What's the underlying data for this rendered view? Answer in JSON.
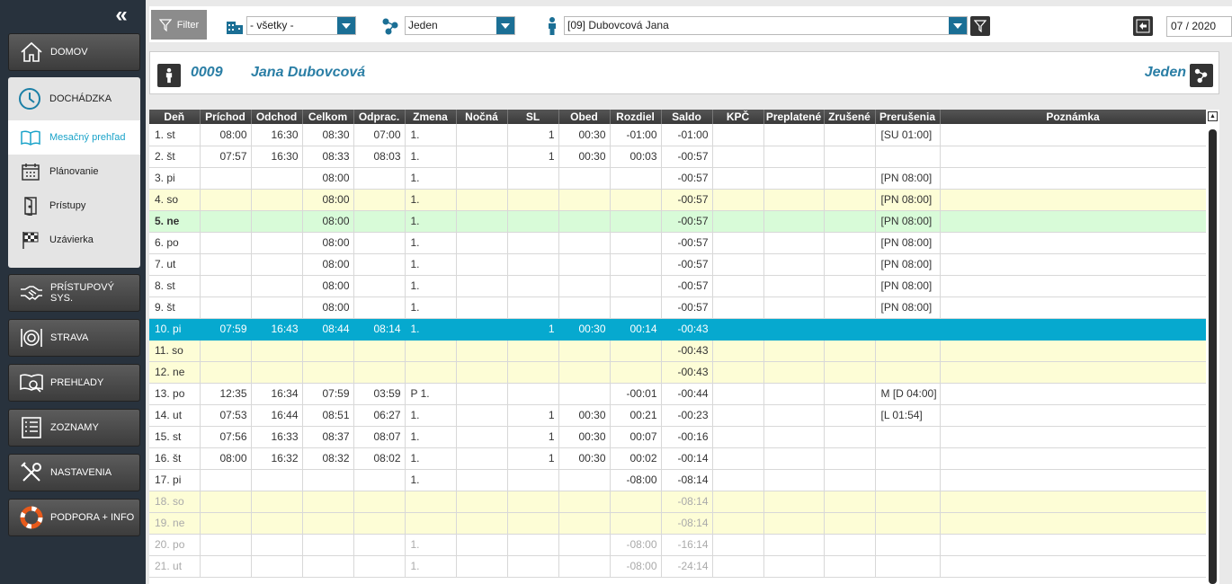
{
  "sidebar": {
    "nav": [
      {
        "id": "domov",
        "label": "DOMOV",
        "icon": "home-icon"
      },
      {
        "id": "pristupovy",
        "label": "PRÍSTUPOVÝ SYS.",
        "icon": "handshake-icon"
      },
      {
        "id": "strava",
        "label": "STRAVA",
        "icon": "plate-icon"
      },
      {
        "id": "prehlady",
        "label": "PREHĽADY",
        "icon": "book-search-icon"
      },
      {
        "id": "zoznamy",
        "label": "ZOZNAMY",
        "icon": "list-icon"
      },
      {
        "id": "nastavenia",
        "label": "NASTAVENIA",
        "icon": "tools-icon"
      },
      {
        "id": "podpora",
        "label": "PODPORA + INFO",
        "icon": "lifebuoy-icon"
      }
    ],
    "dochadzka": {
      "label": "DOCHÁDZKA",
      "items": [
        {
          "label": "Mesačný prehľad",
          "icon": "open-book-icon",
          "active": true
        },
        {
          "label": "Plánovanie",
          "icon": "calendar-icon"
        },
        {
          "label": "Prístupy",
          "icon": "door-icon"
        },
        {
          "label": "Uzávierka",
          "icon": "checkered-flag-icon"
        }
      ]
    }
  },
  "toolbar": {
    "filter_label": "Filter",
    "department_value": "- všetky -",
    "shift_value": "Jeden",
    "employee_value": "[09] Dubovcová Jana",
    "period_value": "07 / 2020"
  },
  "employee_header": {
    "code": "0009",
    "name": "Jana Dubovcová",
    "shift": "Jeden"
  },
  "table": {
    "columns": [
      "Deň",
      "Príchod",
      "Odchod",
      "Celkom",
      "Odprac.",
      "Zmena",
      "Nočná",
      "SL",
      "Obed",
      "Rozdiel",
      "Saldo",
      "KPČ",
      "Preplatené",
      "Zrušené",
      "Prerušenia",
      "Poznámka"
    ],
    "rows": [
      {
        "type": "normal",
        "cells": [
          "1. st",
          "08:00",
          "16:30",
          "08:30",
          "07:00",
          "1.",
          "",
          "1",
          "00:30",
          "-01:00",
          "-01:00",
          "",
          "",
          "",
          "[SU 01:00]",
          ""
        ]
      },
      {
        "type": "normal",
        "cells": [
          "2. št",
          "07:57",
          "16:30",
          "08:33",
          "08:03",
          "1.",
          "",
          "1",
          "00:30",
          "00:03",
          "-00:57",
          "",
          "",
          "",
          "",
          ""
        ]
      },
      {
        "type": "normal",
        "cells": [
          "3. pi",
          "",
          "",
          "08:00",
          "",
          "1.",
          "",
          "",
          "",
          "",
          "-00:57",
          "",
          "",
          "",
          "[PN 08:00]",
          ""
        ]
      },
      {
        "type": "weekend",
        "cells": [
          "4. so",
          "",
          "",
          "08:00",
          "",
          "1.",
          "",
          "",
          "",
          "",
          "-00:57",
          "",
          "",
          "",
          "[PN 08:00]",
          ""
        ]
      },
      {
        "type": "holiday",
        "cells": [
          "5. ne",
          "",
          "",
          "08:00",
          "",
          "1.",
          "",
          "",
          "",
          "",
          "-00:57",
          "",
          "",
          "",
          "[PN 08:00]",
          ""
        ]
      },
      {
        "type": "normal",
        "cells": [
          "6. po",
          "",
          "",
          "08:00",
          "",
          "1.",
          "",
          "",
          "",
          "",
          "-00:57",
          "",
          "",
          "",
          "[PN 08:00]",
          ""
        ]
      },
      {
        "type": "normal",
        "cells": [
          "7. ut",
          "",
          "",
          "08:00",
          "",
          "1.",
          "",
          "",
          "",
          "",
          "-00:57",
          "",
          "",
          "",
          "[PN 08:00]",
          ""
        ]
      },
      {
        "type": "normal",
        "cells": [
          "8. st",
          "",
          "",
          "08:00",
          "",
          "1.",
          "",
          "",
          "",
          "",
          "-00:57",
          "",
          "",
          "",
          "[PN 08:00]",
          ""
        ]
      },
      {
        "type": "normal",
        "cells": [
          "9. št",
          "",
          "",
          "08:00",
          "",
          "1.",
          "",
          "",
          "",
          "",
          "-00:57",
          "",
          "",
          "",
          "[PN 08:00]",
          ""
        ]
      },
      {
        "type": "selected",
        "cells": [
          "10. pi",
          "07:59",
          "16:43",
          "08:44",
          "08:14",
          "1.",
          "",
          "1",
          "00:30",
          "00:14",
          "-00:43",
          "",
          "",
          "",
          "",
          ""
        ]
      },
      {
        "type": "weekend",
        "cells": [
          "11. so",
          "",
          "",
          "",
          "",
          "",
          "",
          "",
          "",
          "",
          "-00:43",
          "",
          "",
          "",
          "",
          ""
        ]
      },
      {
        "type": "weekend",
        "cells": [
          "12. ne",
          "",
          "",
          "",
          "",
          "",
          "",
          "",
          "",
          "",
          "-00:43",
          "",
          "",
          "",
          "",
          ""
        ]
      },
      {
        "type": "normal",
        "cells": [
          "13. po",
          "12:35",
          "16:34",
          "07:59",
          "03:59",
          "P 1.",
          "",
          "",
          "",
          "-00:01",
          "-00:44",
          "",
          "",
          "",
          "M [D 04:00]",
          ""
        ]
      },
      {
        "type": "normal",
        "cells": [
          "14. ut",
          "07:53",
          "16:44",
          "08:51",
          "06:27",
          "1.",
          "",
          "1",
          "00:30",
          "00:21",
          "-00:23",
          "",
          "",
          "",
          "[L 01:54]",
          ""
        ]
      },
      {
        "type": "normal",
        "cells": [
          "15. st",
          "07:56",
          "16:33",
          "08:37",
          "08:07",
          "1.",
          "",
          "1",
          "00:30",
          "00:07",
          "-00:16",
          "",
          "",
          "",
          "",
          ""
        ]
      },
      {
        "type": "normal",
        "cells": [
          "16. št",
          "08:00",
          "16:32",
          "08:32",
          "08:02",
          "1.",
          "",
          "1",
          "00:30",
          "00:02",
          "-00:14",
          "",
          "",
          "",
          "",
          ""
        ]
      },
      {
        "type": "normal",
        "cells": [
          "17. pi",
          "",
          "",
          "",
          "",
          "1.",
          "",
          "",
          "",
          "-08:00",
          "-08:14",
          "",
          "",
          "",
          "",
          ""
        ]
      },
      {
        "type": "weekend fut",
        "cells": [
          "18. so",
          "",
          "",
          "",
          "",
          "",
          "",
          "",
          "",
          "",
          "-08:14",
          "",
          "",
          "",
          "",
          ""
        ]
      },
      {
        "type": "weekend fut",
        "cells": [
          "19. ne",
          "",
          "",
          "",
          "",
          "",
          "",
          "",
          "",
          "",
          "-08:14",
          "",
          "",
          "",
          "",
          ""
        ]
      },
      {
        "type": "fut",
        "cells": [
          "20. po",
          "",
          "",
          "",
          "",
          "1.",
          "",
          "",
          "",
          "-08:00",
          "-16:14",
          "",
          "",
          "",
          "",
          ""
        ]
      },
      {
        "type": "fut",
        "cells": [
          "21. ut",
          "",
          "",
          "",
          "",
          "1.",
          "",
          "",
          "",
          "-08:00",
          "-24:14",
          "",
          "",
          "",
          "",
          ""
        ]
      }
    ]
  }
}
